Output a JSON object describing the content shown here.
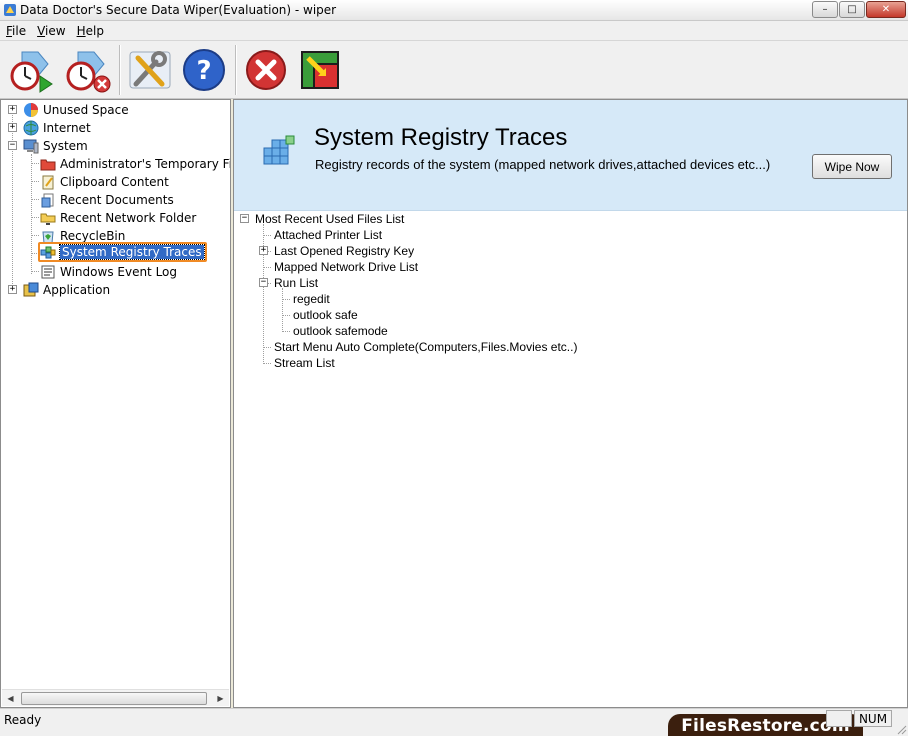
{
  "window": {
    "title": "Data Doctor's Secure Data Wiper(Evaluation) - wiper",
    "minimize_glyph": "–",
    "maximize_glyph": "□",
    "close_glyph": "✕"
  },
  "menu": [
    {
      "label": "File",
      "accel": "F",
      "rest": "ile"
    },
    {
      "label": "View",
      "accel": "V",
      "rest": "iew"
    },
    {
      "label": "Help",
      "accel": "H",
      "rest": "elp"
    }
  ],
  "toolbar": {
    "buttons": [
      {
        "name": "schedule-start-button",
        "icon": "clock-play-icon"
      },
      {
        "name": "schedule-stop-button",
        "icon": "clock-stop-icon"
      },
      {
        "name": "settings-button",
        "icon": "tools-icon"
      },
      {
        "name": "help-button",
        "icon": "help-icon"
      },
      {
        "name": "exit-button",
        "icon": "close-circle-icon"
      },
      {
        "name": "switch-button",
        "icon": "switch-icon"
      }
    ]
  },
  "left_tree": {
    "items": [
      {
        "label": "Unused Space",
        "icon": "pie-chart-icon",
        "expandable": true
      },
      {
        "label": "Internet",
        "icon": "globe-icon",
        "expandable": true
      },
      {
        "label": "System",
        "icon": "computer-icon",
        "expandable": true,
        "expanded": true
      },
      {
        "label": "Administrator's Temporary Files",
        "icon": "folder-red-icon"
      },
      {
        "label": "Clipboard Content",
        "icon": "clipboard-icon"
      },
      {
        "label": "Recent Documents",
        "icon": "documents-icon"
      },
      {
        "label": "Recent Network Folder",
        "icon": "network-folder-icon"
      },
      {
        "label": "RecycleBin",
        "icon": "recycle-bin-icon"
      },
      {
        "label": "System Registry Traces",
        "icon": "registry-icon",
        "selected": true
      },
      {
        "label": "Windows Event Log",
        "icon": "event-log-icon"
      },
      {
        "label": "Application",
        "icon": "application-icon",
        "expandable": true
      }
    ]
  },
  "panel": {
    "title": "System Registry Traces",
    "description": "Registry records of the system (mapped network drives,attached devices etc...)",
    "wipe_label": "Wipe Now",
    "icon": "registry-cubes-icon"
  },
  "right_tree": {
    "root": "Most Recent Used Files List",
    "children": [
      {
        "label": "Attached Printer List"
      },
      {
        "label": "Last Opened Registry Key",
        "expandable": true
      },
      {
        "label": "Mapped Network Drive List"
      },
      {
        "label": "Run List",
        "expandable": true,
        "expanded": true
      },
      {
        "label": "regedit",
        "level": 2
      },
      {
        "label": "outlook safe",
        "level": 2
      },
      {
        "label": "outlook safemode",
        "level": 2
      },
      {
        "label": "Start Menu Auto Complete(Computers,Files.Movies etc..)"
      },
      {
        "label": "Stream List"
      }
    ]
  },
  "status": {
    "text": "Ready",
    "num": "NUM",
    "watermark": "FilesRestore.com"
  },
  "glyphs": {
    "plus": "+",
    "minus": "−",
    "left_arrow": "◀",
    "right_arrow": "▶"
  }
}
